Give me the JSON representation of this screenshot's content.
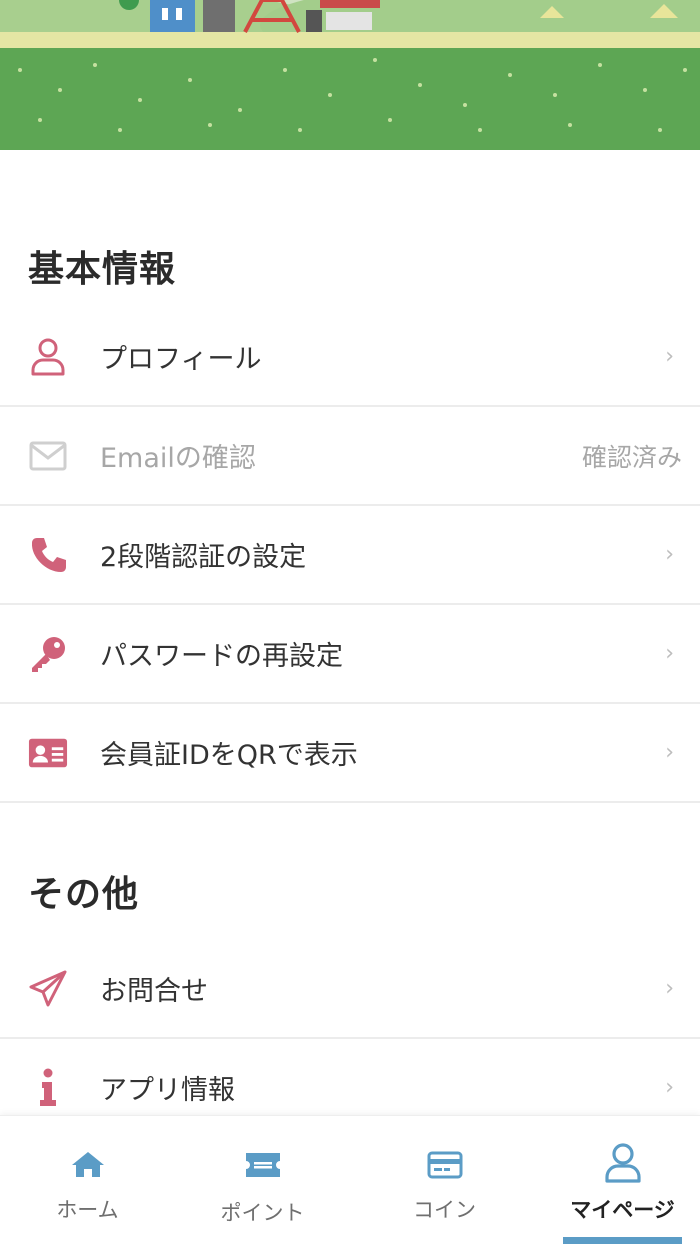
{
  "colors": {
    "accent_pink": "#d0627a",
    "tab_blue": "#5b9cc6",
    "disabled_gray": "#cfcfcf"
  },
  "sections": [
    {
      "title": "基本情報",
      "items": [
        {
          "label": "プロフィール",
          "icon": "user-icon",
          "right": "chevron"
        },
        {
          "label": "Emailの確認",
          "icon": "envelope-icon",
          "right_text": "確認済み",
          "disabled": true
        },
        {
          "label": "2段階認証の設定",
          "icon": "phone-icon",
          "right": "chevron"
        },
        {
          "label": "パスワードの再設定",
          "icon": "key-icon",
          "right": "chevron"
        },
        {
          "label": "会員証IDをQRで表示",
          "icon": "id-card-icon",
          "right": "chevron"
        }
      ]
    },
    {
      "title": "その他",
      "items": [
        {
          "label": "お問合せ",
          "icon": "paper-plane-icon",
          "right": "chevron"
        },
        {
          "label": "アプリ情報",
          "icon": "info-icon",
          "right": "chevron"
        }
      ]
    }
  ],
  "chevron": "›",
  "tabbar": {
    "tabs": [
      {
        "label": "ホーム",
        "icon": "home-icon"
      },
      {
        "label": "ポイント",
        "icon": "ticket-icon"
      },
      {
        "label": "コイン",
        "icon": "card-icon"
      },
      {
        "label": "マイページ",
        "icon": "user-icon",
        "active": true
      }
    ]
  }
}
